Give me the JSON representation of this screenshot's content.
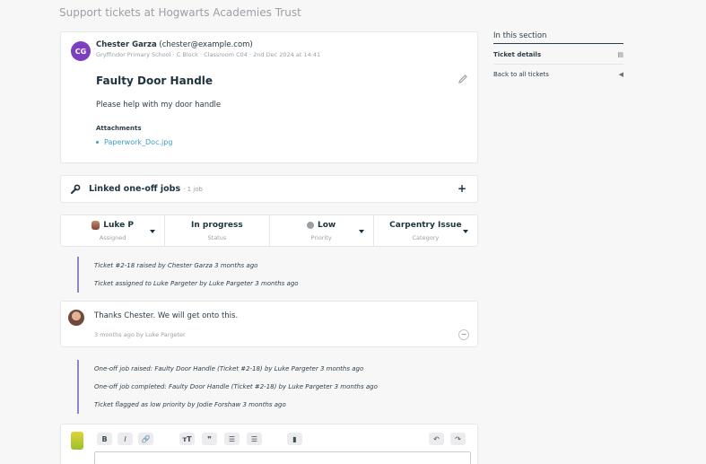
{
  "header": {
    "subtitle": "Support tickets at Hogwarts Academies Trust"
  },
  "ticket": {
    "avatar_initials": "CG",
    "author_name": "Chester Garza",
    "author_email": "(chester@example.com)",
    "meta": "Gryffindor Primary School · C Block · Classroom C04 · 2nd Dec 2024 at 14:41",
    "title": "Faulty Door Handle",
    "body": "Please help with my door handle",
    "attachments_heading": "Attachments",
    "attachments": [
      "Paperwork_Doc.jpg"
    ]
  },
  "linked_jobs": {
    "label": "Linked one-off jobs",
    "count": "· 1 job",
    "add_symbol": "+"
  },
  "status_bar": {
    "assigned": {
      "value": "Luke P",
      "label": "Assigned"
    },
    "status": {
      "value": "In progress",
      "label": "Status"
    },
    "priority": {
      "value": "Low",
      "label": "Priority"
    },
    "category": {
      "value": "Carpentry Issue",
      "label": "Category"
    }
  },
  "activity_1": [
    "Ticket #2-18 raised by Chester Garza 3 months ago",
    "Ticket assigned to Luke Pargeter by Luke Pargeter 3 months ago"
  ],
  "comment": {
    "text": "Thanks Chester. We will get onto this.",
    "meta": "3 months ago by Luke Pargeter",
    "collapse_symbol": "−"
  },
  "activity_2": [
    "One-off job raised: Faulty Door Handle (Ticket #2-18) by Luke Pargeter 3 months ago",
    "One-off job completed: Faulty Door Handle (Ticket #2-18) by Luke Pargeter 3 months ago",
    "Ticket flagged as low priority by Jodie Forshaw 3 months ago"
  ],
  "editor": {
    "toolbar": {
      "bold": "B",
      "italic": "I",
      "link": "🔗",
      "heading": "тT",
      "quote": "❞",
      "bullets": "☰",
      "numbers": "☰",
      "attach": "▮",
      "undo": "↶",
      "redo": "↷"
    }
  },
  "sidebar": {
    "title": "In this section",
    "items": [
      {
        "label": "Ticket details",
        "icon": "document-icon",
        "glyph": "▤"
      },
      {
        "label": "Back to all tickets",
        "icon": "back-arrow-icon",
        "glyph": "◀"
      }
    ]
  },
  "colors": {
    "accent": "#8e86c8",
    "avatar_purple": "#7b3fc0",
    "link": "#3aa0c8"
  }
}
